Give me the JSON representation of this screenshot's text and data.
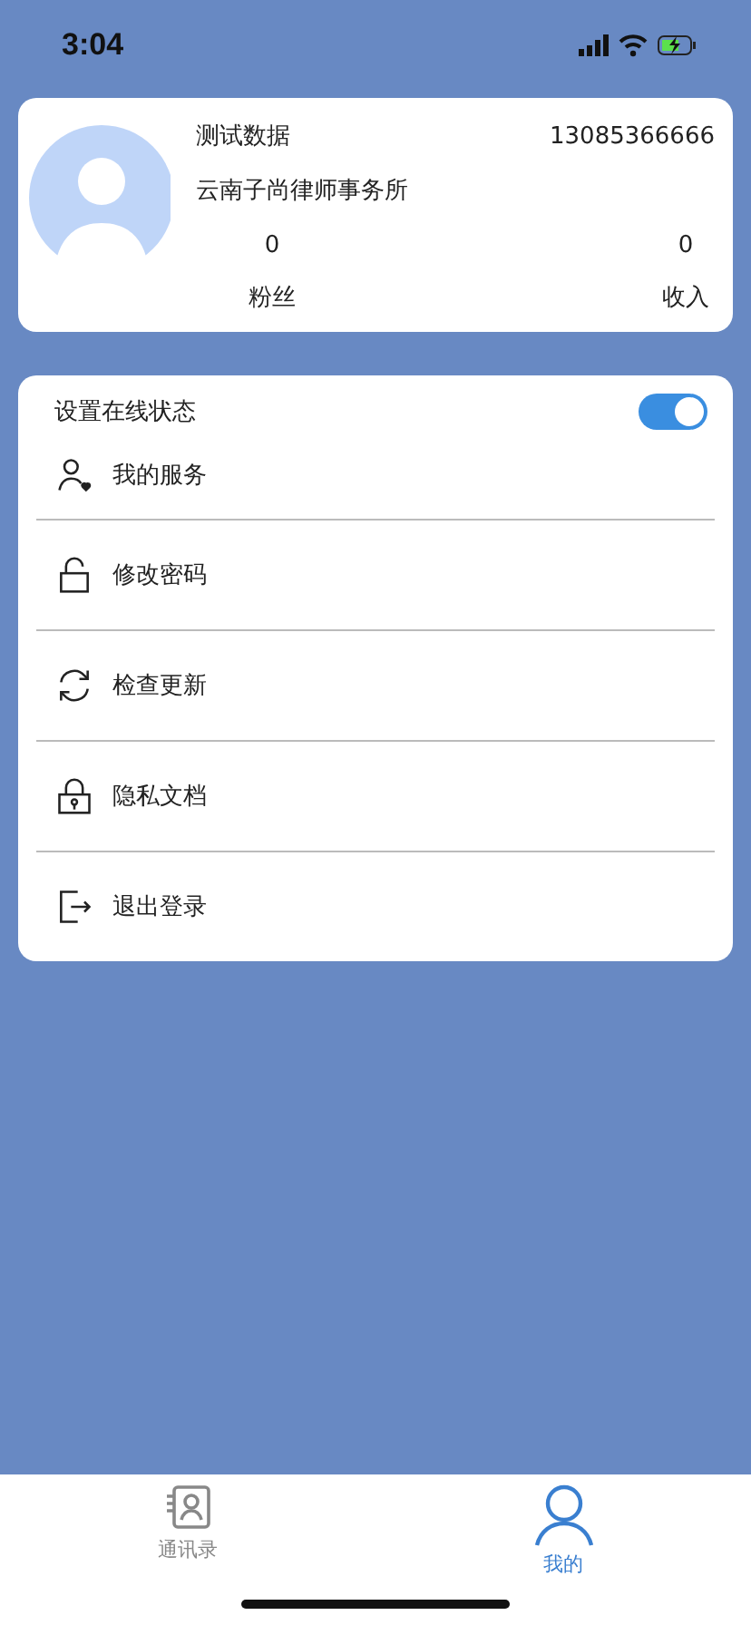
{
  "status_bar": {
    "time": "3:04"
  },
  "profile": {
    "name": "测试数据",
    "phone": "13085366666",
    "firm": "云南子尚律师事务所",
    "stats": [
      {
        "value": "0",
        "label": "粉丝"
      },
      {
        "value": "0",
        "label": "收入"
      }
    ]
  },
  "online_status": {
    "label": "设置在线状态",
    "on": true
  },
  "menu": [
    {
      "kind": "service",
      "label": "我的服务"
    },
    {
      "kind": "unlock",
      "label": "修改密码"
    },
    {
      "kind": "refresh",
      "label": "检查更新"
    },
    {
      "kind": "lock",
      "label": "隐私文档"
    },
    {
      "kind": "logout",
      "label": "退出登录"
    }
  ],
  "tabs": [
    {
      "kind": "contacts",
      "label": "通讯录",
      "selected": false
    },
    {
      "kind": "me",
      "label": "我的",
      "selected": true
    }
  ]
}
